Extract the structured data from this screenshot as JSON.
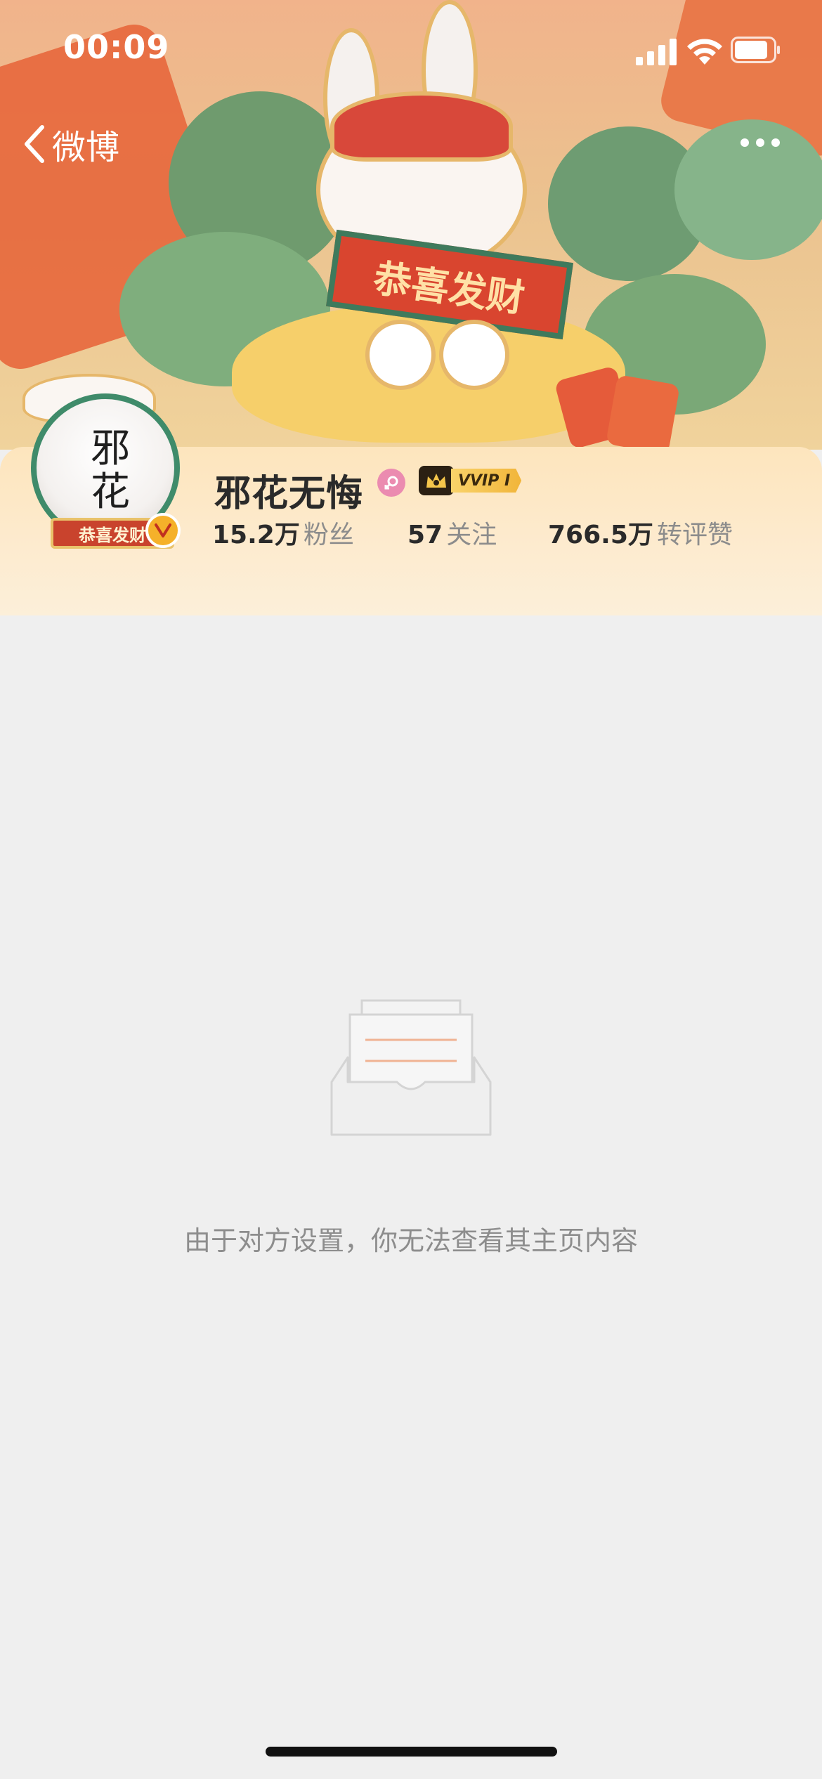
{
  "status_bar": {
    "time": "00:09"
  },
  "nav": {
    "back_label": "微博",
    "more_icon": "ellipsis-icon"
  },
  "banner": {
    "plaque_text": "恭喜发财"
  },
  "profile": {
    "avatar_text": "邪花无悔",
    "avatar_plaque": "恭喜发财",
    "name": "邪花无悔",
    "vip_label": "VVIP I",
    "stats": [
      {
        "value": "15.2万",
        "label": "粉丝"
      },
      {
        "value": "57",
        "label": "关注"
      },
      {
        "value": "766.5万",
        "label": "转评赞"
      }
    ]
  },
  "empty_state": {
    "message": "由于对方设置，你无法查看其主页内容"
  },
  "colors": {
    "page_bg": "#efefef",
    "card_bg": "#fde5bd",
    "gender_badge": "#eb8bb0",
    "verified_badge": "#f5b12a"
  }
}
